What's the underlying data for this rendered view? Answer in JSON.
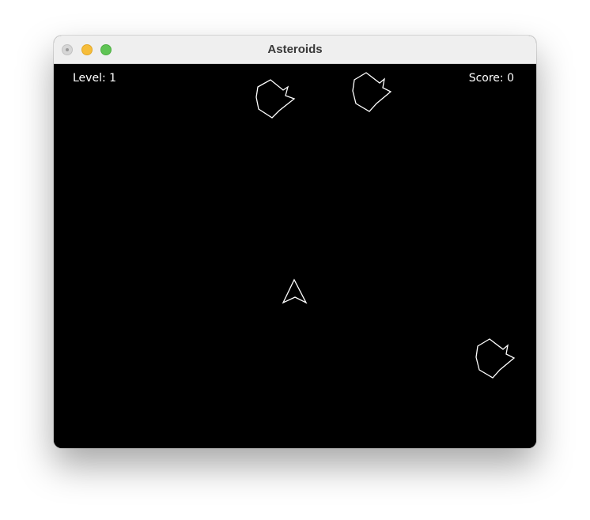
{
  "window": {
    "title": "Asteroids"
  },
  "hud": {
    "level_label": "Level: 1",
    "score_label": "Score: 0"
  },
  "colors": {
    "background": "#000000",
    "stroke": "#ffffff",
    "titlebar": "#efefef"
  }
}
